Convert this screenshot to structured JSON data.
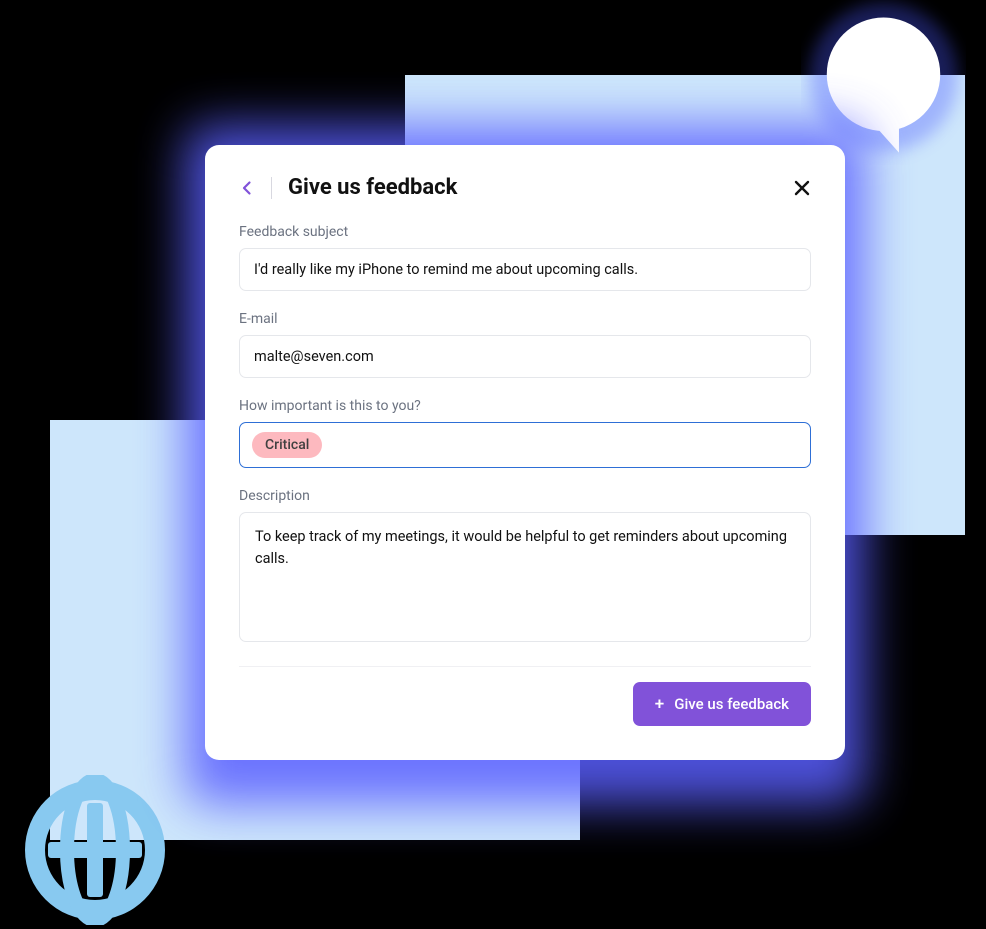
{
  "header": {
    "title": "Give us feedback"
  },
  "fields": {
    "subject": {
      "label": "Feedback subject",
      "value": "I'd really like my iPhone to remind me about upcoming calls."
    },
    "email": {
      "label": "E-mail",
      "value": "malte@seven.com"
    },
    "importance": {
      "label": "How important is this to you?",
      "selected": "Critical"
    },
    "description": {
      "label": "Description",
      "value": "To keep track of my meetings, it would be helpful to get reminders about upcoming calls."
    }
  },
  "submit": {
    "label": "Give us feedback"
  },
  "colors": {
    "accent": "#8152d9",
    "focus_border": "#2e6fd6",
    "chip_bg": "#fdb9bf",
    "bg_light_blue": "#cde6fb",
    "glow": "#5a5fff"
  }
}
